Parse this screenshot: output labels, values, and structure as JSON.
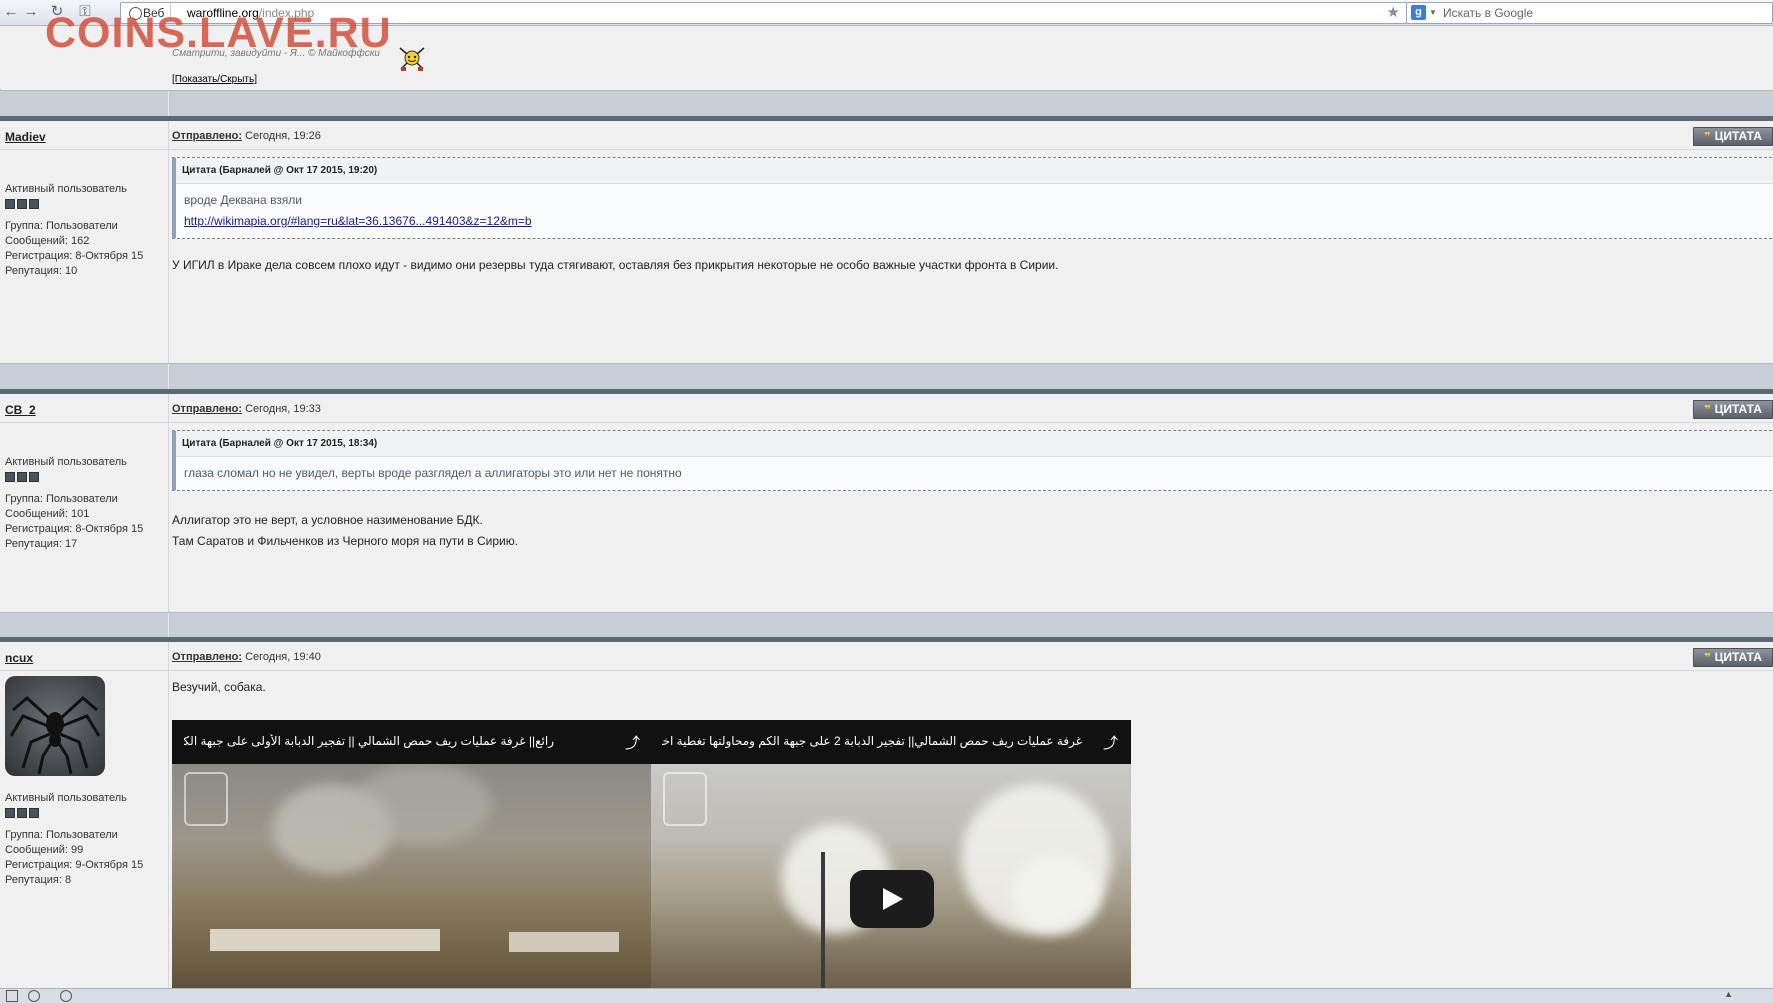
{
  "browser": {
    "web_tag": "Веб",
    "url_domain": "waroffline.org",
    "url_path": "/index.php",
    "search_placeholder": "Искать в Google"
  },
  "watermark": "COINS.LAVE.RU",
  "signature": {
    "text": "Сматрити, завидуйти - Я... © Майкоффски",
    "show_hide": "[Показать/Скрыть]"
  },
  "posts": [
    {
      "author": "Madiev",
      "posted_label": "Отправлено:",
      "posted_time": "Сегодня, 19:26",
      "quote_button": "ЦИТАТА",
      "rank": "Активный пользователь",
      "group": "Группа: Пользователи",
      "messages": "Сообщений: 162",
      "registration": "Регистрация: 8-Октября 15",
      "reputation": "Репутация: 10",
      "quote_header": "Цитата (Барналей @ Окт 17 2015, 19:20)",
      "quote_line1": "вроде Деквана взяли",
      "quote_link": "http://wikimapia.org/#lang=ru&lat=36.13676...491403&z=12&m=b",
      "text_line1": "У ИГИЛ в Ираке дела совсем плохо идут - видимо они резервы туда стягивают, оставляя без прикрытия некоторые не особо важные участки фронта в Сирии."
    },
    {
      "author": "CB_2",
      "posted_label": "Отправлено:",
      "posted_time": "Сегодня, 19:33",
      "quote_button": "ЦИТАТА",
      "rank": "Активный пользователь",
      "group": "Группа: Пользователи",
      "messages": "Сообщений: 101",
      "registration": "Регистрация: 8-Октября 15",
      "reputation": "Репутация: 17",
      "quote_header": "Цитата (Барналей @ Окт 17 2015, 18:34)",
      "quote_line1": "глаза сломал но не увидел, верты вроде разглядел а аллигаторы это или нет не понятно",
      "text_line1": "Аллигатор это не верт, а условное назименование БДК.",
      "text_line2": "Там Саратов и Фильченков из Черного моря на пути в Сирию."
    },
    {
      "author": "ncux",
      "posted_label": "Отправлено:",
      "posted_time": "Сегодня, 19:40",
      "quote_button": "ЦИТАТА",
      "rank": "Активный пользователь",
      "group": "Группа: Пользователи",
      "messages": "Сообщений: 99",
      "registration": "Регистрация: 9-Октября 15",
      "reputation": "Репутация: 8",
      "text_line1": "Везучий, собака.",
      "video_title_left": "رائع|| غرفة عمليات ريف حمص الشمالي || تفجير الدبابة الأولى على جبهة الكم اليوم",
      "video_title_right": "غرفة عمليات ريف حمص الشمالي|| تفجير الدبابة 2 على جبهة الكم ومحاولتها تغطية اخلاء جرحى الاسد"
    }
  ],
  "colors": {
    "watermark": "#d2503c",
    "separator": "#c8ced6",
    "post_top_bar": "#5d6875",
    "quote_button": "#5b626b"
  }
}
